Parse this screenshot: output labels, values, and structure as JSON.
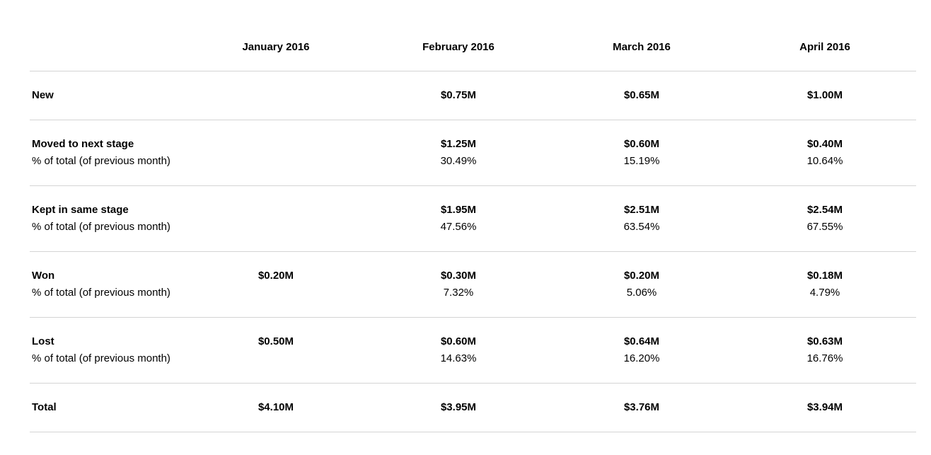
{
  "chart_data": {
    "type": "table",
    "columns": [
      "January 2016",
      "February 2016",
      "March 2016",
      "April 2016"
    ],
    "rows": [
      {
        "label": "New",
        "sublabel": "",
        "values": [
          "",
          "$0.75M",
          "$0.65M",
          "$1.00M"
        ],
        "percents": [
          "",
          "",
          "",
          ""
        ]
      },
      {
        "label": "Moved to next stage",
        "sublabel": "% of total (of previous month)",
        "values": [
          "",
          "$1.25M",
          "$0.60M",
          "$0.40M"
        ],
        "percents": [
          "",
          "30.49%",
          "15.19%",
          "10.64%"
        ]
      },
      {
        "label": "Kept in same stage",
        "sublabel": "% of total (of previous month)",
        "values": [
          "",
          "$1.95M",
          "$2.51M",
          "$2.54M"
        ],
        "percents": [
          "",
          "47.56%",
          "63.54%",
          "67.55%"
        ]
      },
      {
        "label": "Won",
        "sublabel": "% of total (of previous month)",
        "values": [
          "$0.20M",
          "$0.30M",
          "$0.20M",
          "$0.18M"
        ],
        "percents": [
          "",
          "7.32%",
          "5.06%",
          "4.79%"
        ]
      },
      {
        "label": "Lost",
        "sublabel": "% of total (of previous month)",
        "values": [
          "$0.50M",
          "$0.60M",
          "$0.64M",
          "$0.63M"
        ],
        "percents": [
          "",
          "14.63%",
          "16.20%",
          "16.76%"
        ]
      },
      {
        "label": "Total",
        "sublabel": "",
        "values": [
          "$4.10M",
          "$3.95M",
          "$3.76M",
          "$3.94M"
        ],
        "percents": [
          "",
          "",
          "",
          ""
        ]
      }
    ]
  }
}
